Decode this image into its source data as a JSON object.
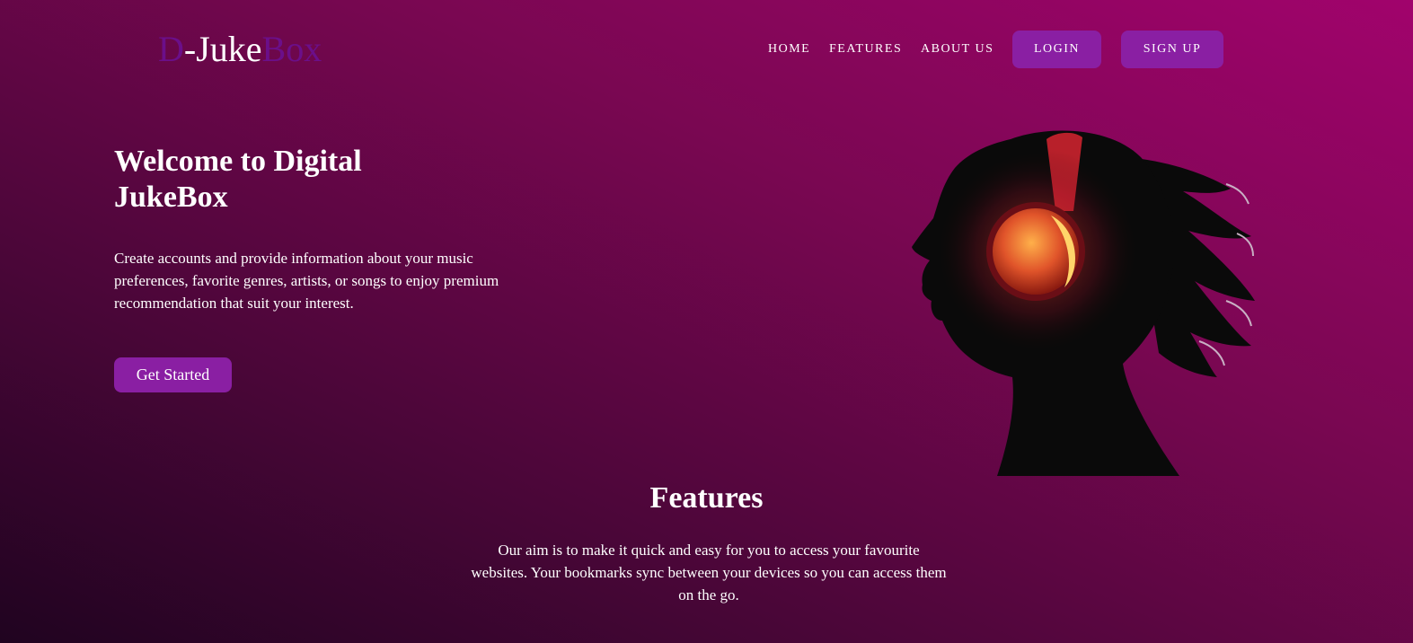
{
  "header": {
    "logo": {
      "part1": "D",
      "part2": "-Juke",
      "part3": "Box"
    },
    "nav": {
      "home": "HOME",
      "features": "FEATURES",
      "about": "ABOUT US"
    },
    "login_label": "LOGIN",
    "signup_label": "SIGN UP"
  },
  "hero": {
    "title": "Welcome to Digital JukeBox",
    "description": "Create accounts and provide information about your music preferences, favorite genres, artists, or songs to enjoy premium recommendation that suit your interest.",
    "cta_label": "Get Started",
    "illustration_icon": "headphones-silhouette-icon"
  },
  "features": {
    "title": "Features",
    "description": "Our aim is to make it quick and easy for you to access your favourite websites. Your bookmarks sync between your devices so you can access them on the go."
  },
  "colors": {
    "accent_purple": "#8a1fa3",
    "logo_accent": "#6b0f8a",
    "bg_dark": "#200420",
    "bg_magenta": "#a1036c"
  }
}
